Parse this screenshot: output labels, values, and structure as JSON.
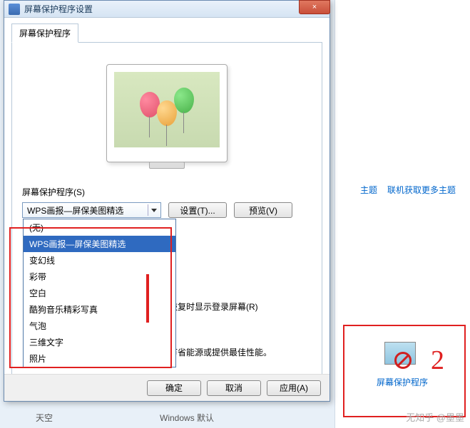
{
  "dialog": {
    "title": "屏幕保护程序设置",
    "close": "×",
    "tab": "屏幕保护程序",
    "group_label": "屏幕保护程序(S)",
    "combo_value": "WPS画报—屏保美图精选",
    "settings_btn": "设置(T)...",
    "preview_btn": "预览(V)",
    "resume_label": "恢复时显示登录屏幕(R)",
    "power_hint": "节省能源或提供最佳性能。",
    "ok_btn": "确定",
    "cancel_btn": "取消",
    "apply_btn": "应用(A)",
    "options": [
      "(无)",
      "WPS画报—屏保美图精选",
      "变幻线",
      "彩带",
      "空白",
      "酷狗音乐精彩写真",
      "气泡",
      "三维文字",
      "照片"
    ]
  },
  "bg": {
    "link1": "主题",
    "link2": "联机获取更多主题",
    "ssaver_link": "屏幕保护程序"
  },
  "bottom": {
    "item1": "天空",
    "item2": "Windows 默认"
  },
  "annot": {
    "two": "2"
  },
  "watermark": "无知乎 @墨墨"
}
